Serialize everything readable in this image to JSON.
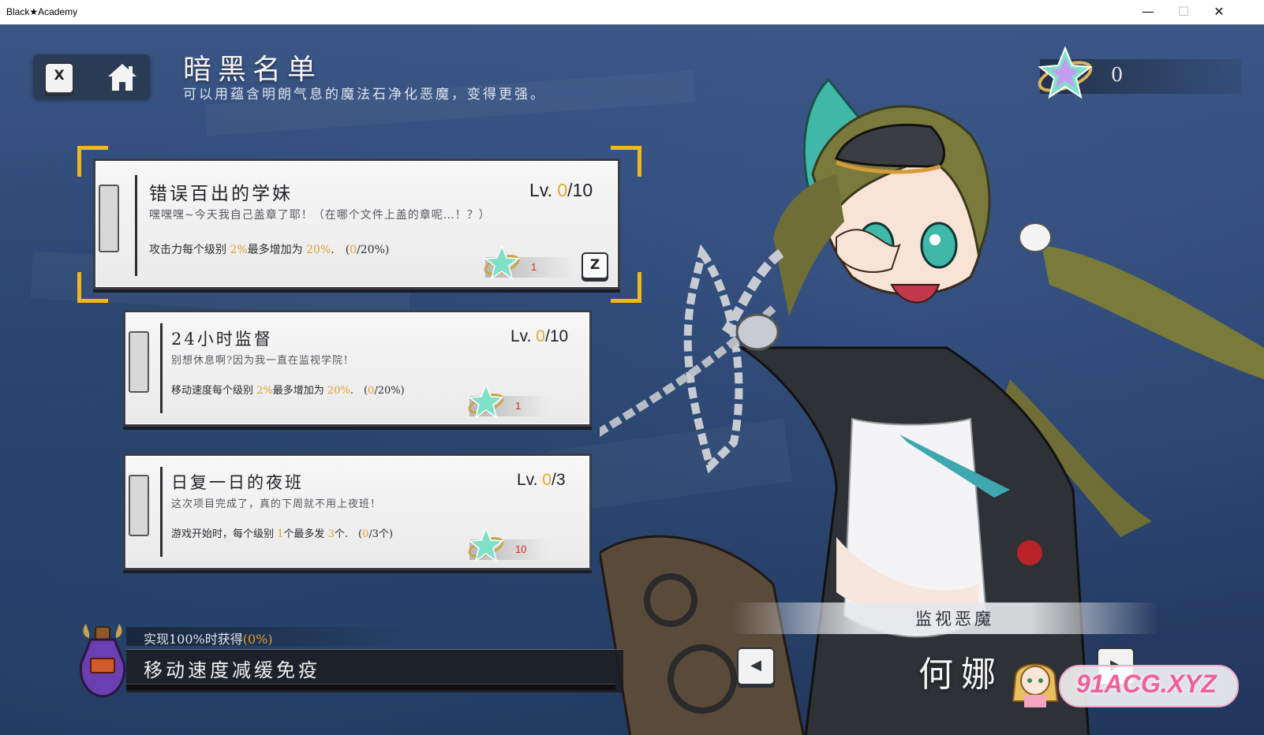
{
  "window": {
    "title": "Black★Academy",
    "minimize": "—",
    "maximize": "☐",
    "close": "✕"
  },
  "header": {
    "close_key": "X",
    "title": "暗黑名单",
    "subtitle": "可以用蕴含明朗气息的魔法石净化恶魔，变得更强。",
    "stone_count": "0"
  },
  "entries": [
    {
      "name": "错误百出的学妹",
      "lv_prefix": "Lv. ",
      "lv_cur": "0",
      "lv_max": "/10",
      "desc": "嘿嘿嘿~今天我自己盖章了耶！（在哪个文件上盖的章呢…！？）",
      "eff_a": "攻击力每个级别 ",
      "eff_b": "2%",
      "eff_c": "最多增加为 ",
      "eff_d": "20%",
      "eff_e": ".　(",
      "eff_f": "0",
      "eff_g": "/20%)",
      "cost": "1",
      "key": "Z",
      "selected": true
    },
    {
      "name": "24小时监督",
      "lv_prefix": "Lv. ",
      "lv_cur": "0",
      "lv_max": "/10",
      "desc": "别想休息啊?因为我一直在监视学院！",
      "eff_a": "移动速度每个级别 ",
      "eff_b": "2%",
      "eff_c": "最多增加为 ",
      "eff_d": "20%",
      "eff_e": ".　(",
      "eff_f": "0",
      "eff_g": "/20%)",
      "cost": "1",
      "selected": false
    },
    {
      "name": "日复一日的夜班",
      "lv_prefix": "Lv. ",
      "lv_cur": "0",
      "lv_max": "/3",
      "desc": "这次项目完成了，真的下周就不用上夜班！",
      "eff_a": "游戏开始时，每个级别 ",
      "eff_b": "1",
      "eff_c": "个最多发 ",
      "eff_d": "3",
      "eff_e": "个.　(",
      "eff_f": "0",
      "eff_g": "/3个)",
      "cost": "10",
      "selected": false
    }
  ],
  "reward": {
    "label": "实现100%时获得",
    "percent": "(0%)",
    "text": "移动速度减缓免疫",
    "progress": 0
  },
  "demon": {
    "label": "监视恶魔",
    "name": "何娜",
    "prev_icon": "◀",
    "next_icon": "▶"
  },
  "watermark": "91ACG.XYZ",
  "colors": {
    "accent": "#e6a52a",
    "bracket": "#f0b81a",
    "cost": "#d02a20",
    "bg": "#2c4572"
  }
}
